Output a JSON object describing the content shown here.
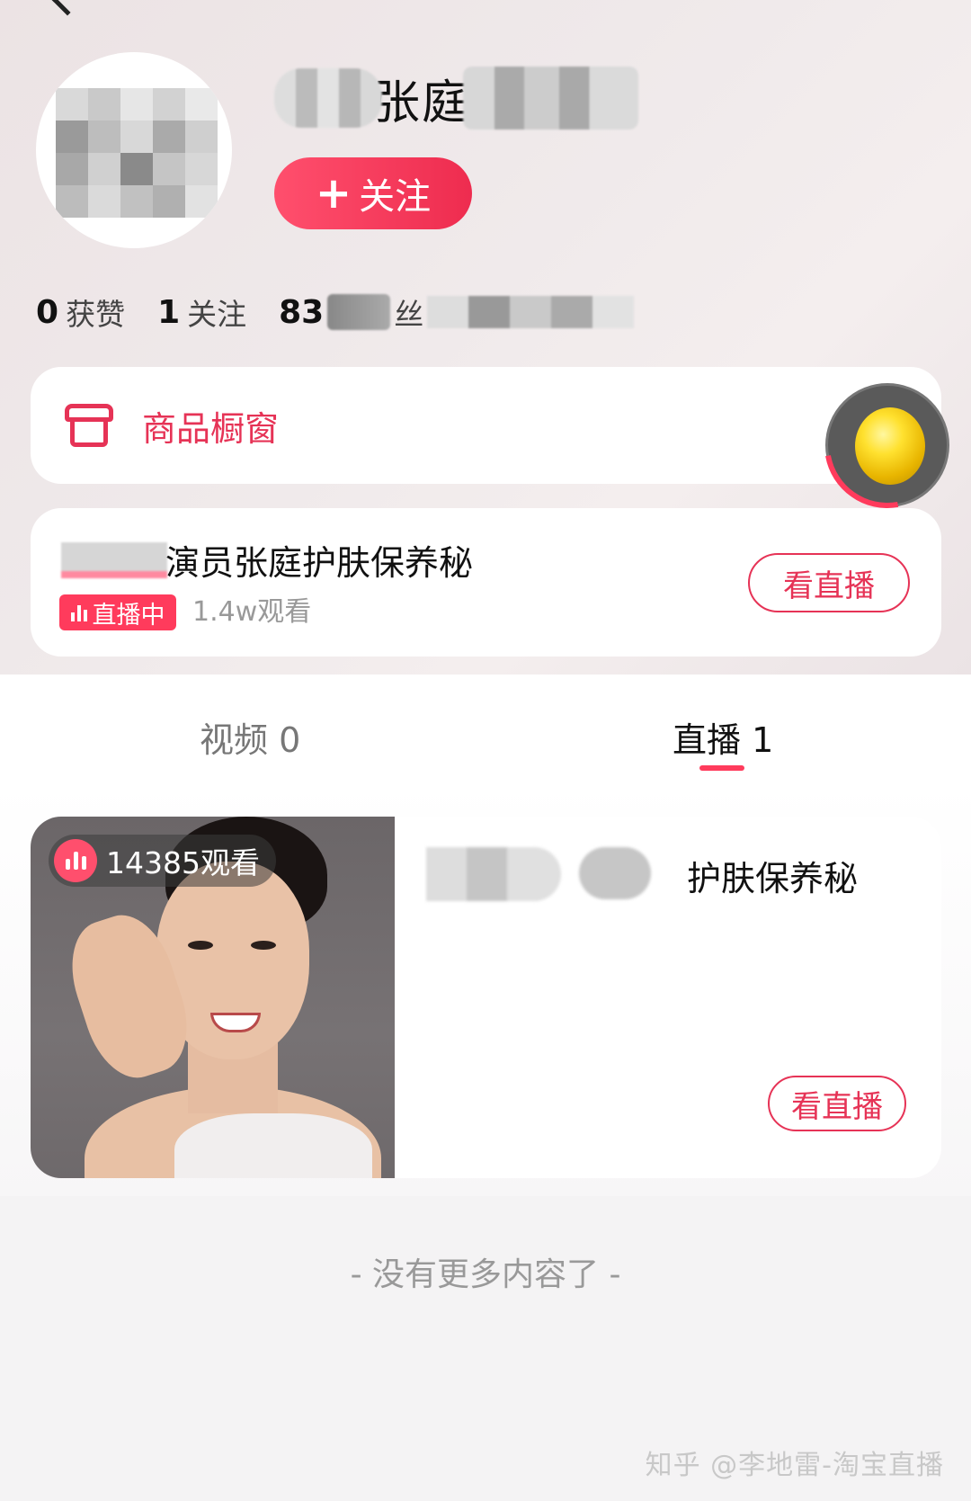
{
  "profile": {
    "name_visible": "张庭",
    "follow_label": "关注",
    "follow_icon": "+"
  },
  "stats": {
    "likes_num": "0",
    "likes_label": "获赞",
    "following_num": "1",
    "following_label": "关注",
    "fans_num": "83",
    "fans_label": "丝"
  },
  "shop": {
    "label": "商品橱窗",
    "icon": "store-icon"
  },
  "live_card": {
    "title": "演员张庭护肤保养秘",
    "badge": "直播中",
    "views": "1.4w观看",
    "button": "看直播"
  },
  "tabs": [
    {
      "label": "视频 0"
    },
    {
      "label": "直播 1"
    }
  ],
  "video_card": {
    "views": "14385观看",
    "title": "护肤保养秘",
    "button": "看直播"
  },
  "footer": {
    "no_more": "- 没有更多内容了 -",
    "watermark": "知乎 @李地雷-淘宝直播"
  },
  "colors": {
    "accent": "#ff3b5c",
    "accent_text": "#e63356"
  }
}
